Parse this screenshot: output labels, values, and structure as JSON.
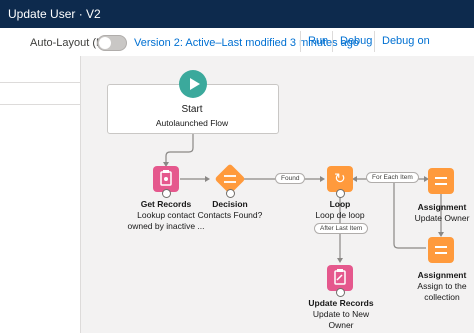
{
  "window": {
    "title": "Update User · V2"
  },
  "toolbar": {
    "auto_layout_label": "Auto-Layout (Beta)",
    "auto_layout_on": false,
    "version_text": "Version 2: Active–Last modified 3 minutes ago",
    "run_label": "Run",
    "debug_label": "Debug",
    "debug_canvas_label": "Debug on Canvas (Beta)"
  },
  "flow": {
    "start": {
      "title": "Start",
      "subtitle": "Autolaunched Flow"
    },
    "get_records": {
      "type": "Get Records",
      "desc1": "Lookup contact",
      "desc2": "owned by inactive ...",
      "color": "#e5588d",
      "icon": "get-records-icon"
    },
    "decision": {
      "type": "Decision",
      "desc1": "Contacts Found?",
      "color": "#ff9a3c",
      "icon": "decision-icon"
    },
    "found_label": "Found",
    "loop": {
      "type": "Loop",
      "desc1": "Loop de loop",
      "color": "#ff9a3c",
      "icon": "loop-icon"
    },
    "for_each_label": "For Each Item",
    "after_last_label": "After Last Item",
    "assignment1": {
      "type": "Assignment",
      "desc1": "Update Owner",
      "color": "#ff9a3c",
      "icon": "assignment-icon"
    },
    "assignment2": {
      "type": "Assignment",
      "desc1": "Assign to the",
      "desc2": "collection",
      "color": "#ff9a3c",
      "icon": "assignment-icon"
    },
    "update_records": {
      "type": "Update Records",
      "desc1": "Update to New",
      "desc2": "Owner",
      "color": "#e5588d",
      "icon": "update-records-icon"
    }
  },
  "colors": {
    "header_bg": "#0d2a4d",
    "link": "#0070d2",
    "start_green": "#3ba99c"
  }
}
